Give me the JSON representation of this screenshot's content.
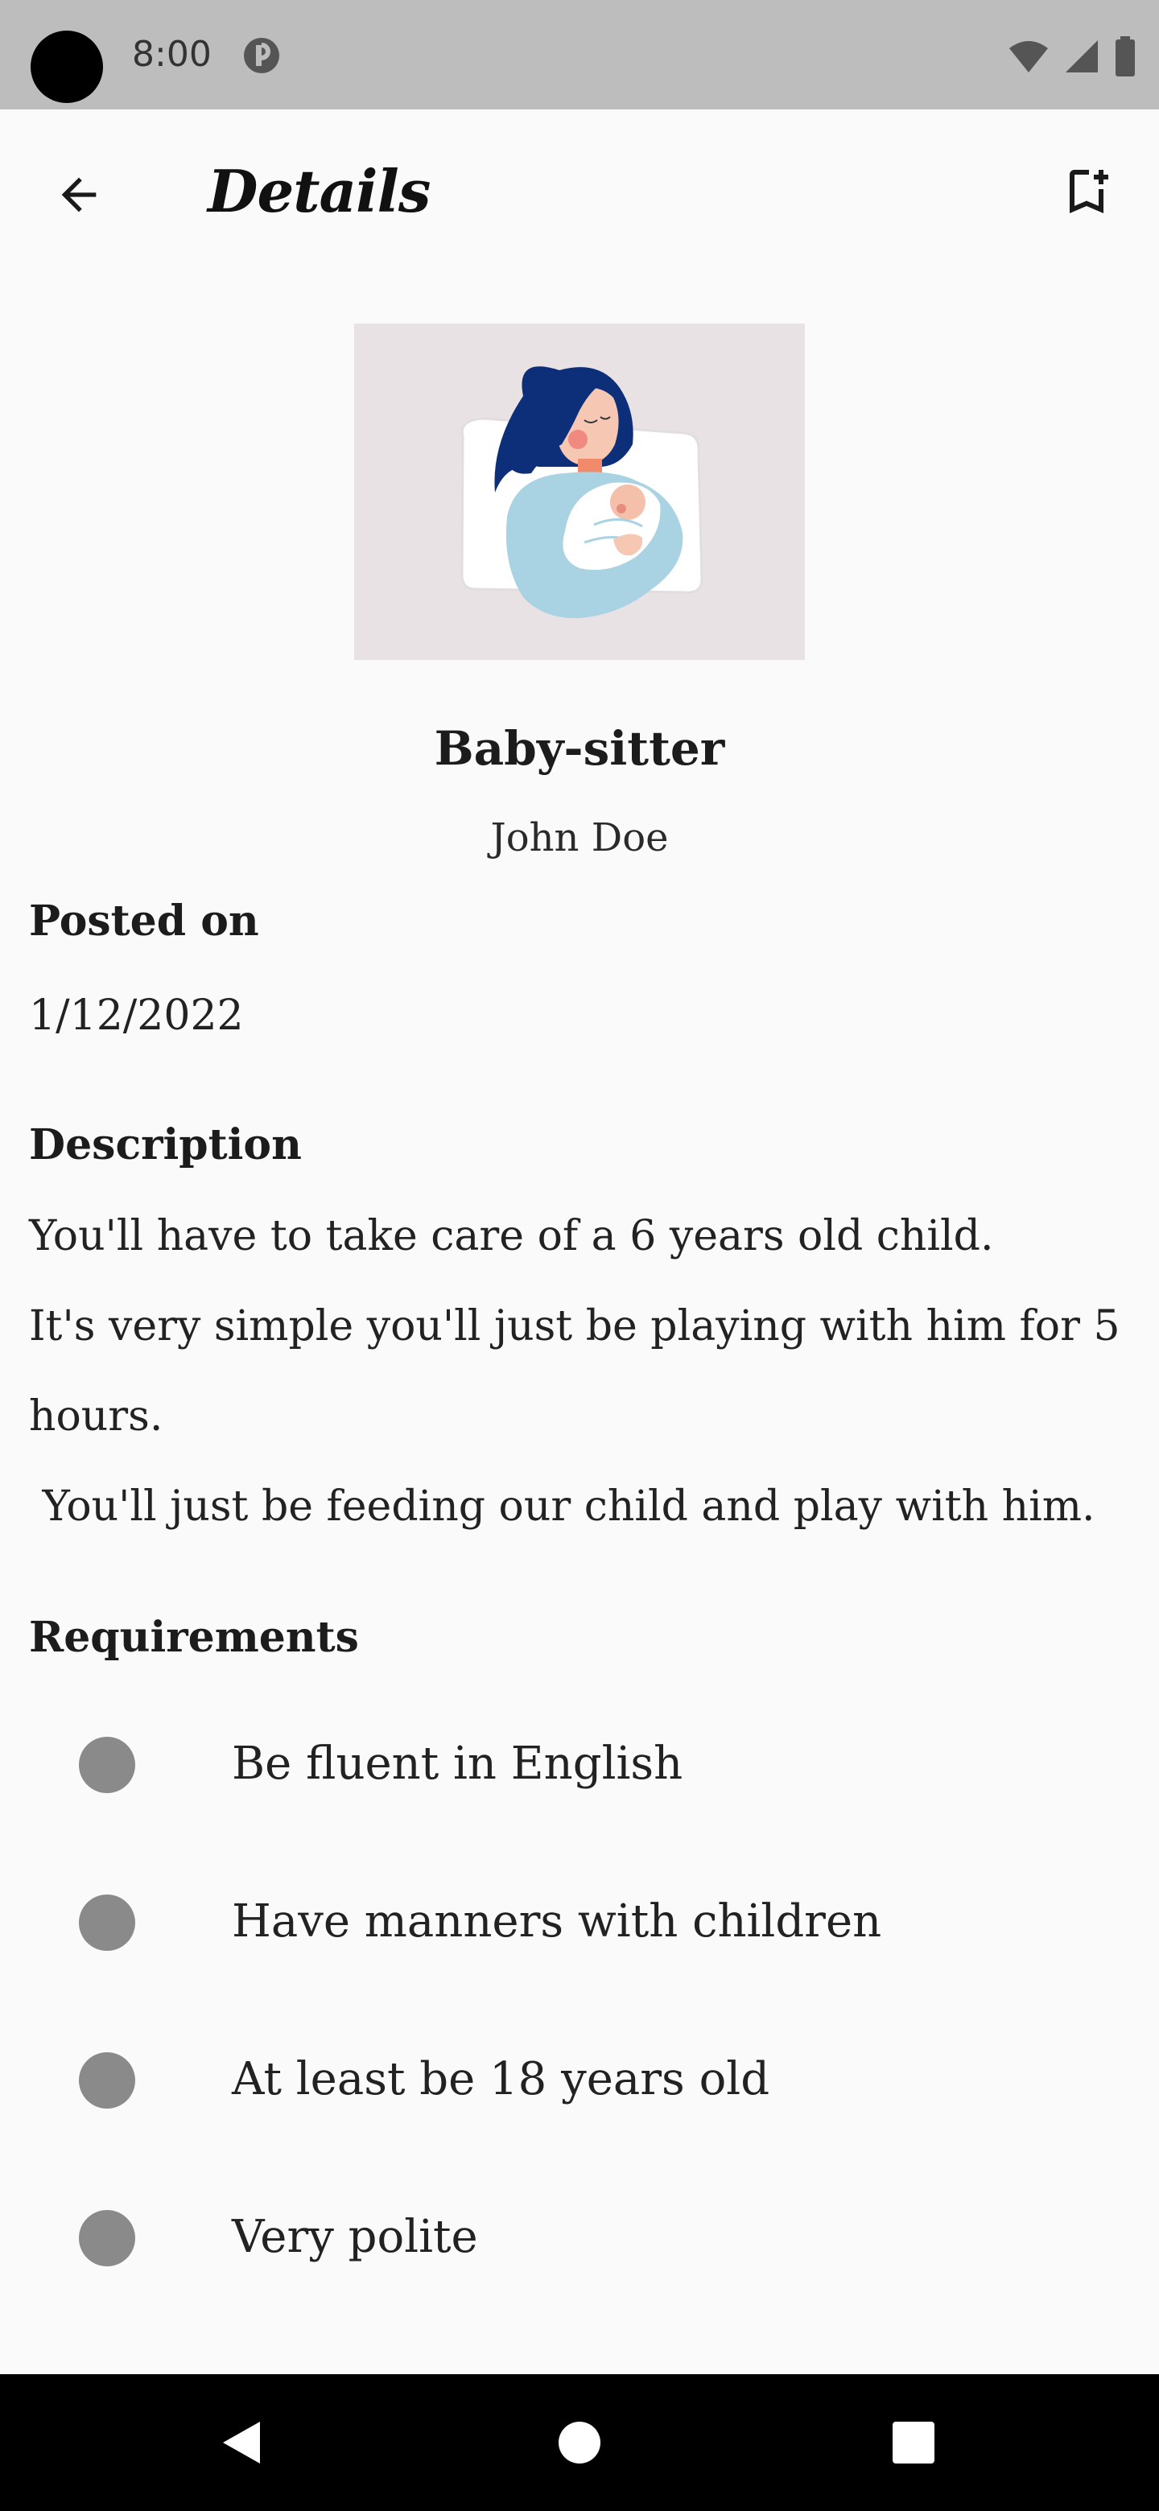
{
  "status_bar": {
    "time": "8:00",
    "icons": [
      "camera-hole",
      "app-notification-icon",
      "wifi-icon",
      "cell-signal-icon",
      "battery-icon"
    ]
  },
  "app_bar": {
    "title": "Details",
    "back_icon": "arrow-back-icon",
    "bookmark_icon": "bookmark-add-icon"
  },
  "job": {
    "title": "Baby-sitter",
    "poster": "John Doe",
    "image": "mother-holding-baby-illustration"
  },
  "posted": {
    "label": "Posted on",
    "date": "1/12/2022"
  },
  "description": {
    "label": "Description",
    "lines": [
      "You'll have to take care of a 6 years old child.",
      "It's very simple you'll just be playing with him for 5",
      "hours.",
      " You'll just be feeding our child and play with him."
    ]
  },
  "requirements": {
    "label": "Requirements",
    "items": [
      "Be fluent in English",
      "Have manners with children",
      "At least be 18 years old",
      "Very polite"
    ]
  },
  "colors": {
    "background": "#fafafa",
    "status_bar": "#bdbdbd",
    "image_bg": "#e8e2e4",
    "bullet": "#8a8a8a",
    "nav_bar": "#000000"
  },
  "nav": {
    "back_icon": "nav-back-icon",
    "home_icon": "nav-home-icon",
    "recents_icon": "nav-recents-icon"
  }
}
